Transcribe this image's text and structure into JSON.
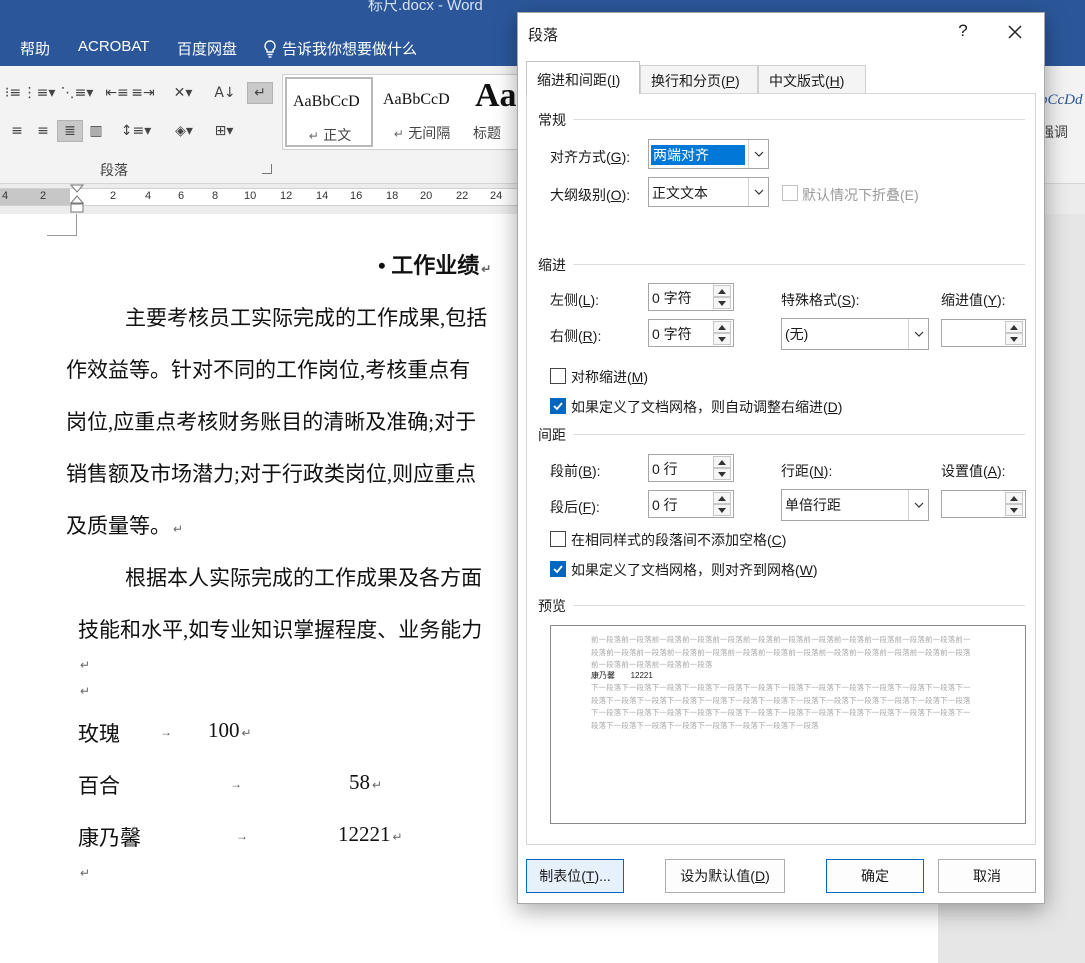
{
  "window": {
    "title": "标尺.docx - Word"
  },
  "menu": {
    "items": [
      "帮助",
      "ACROBAT",
      "百度网盘"
    ],
    "tell_me": "告诉我你想要做什么"
  },
  "ribbon": {
    "group_label": "段落",
    "styles": [
      {
        "sample": "AaBbCcD",
        "name": "正文",
        "mark": "↵"
      },
      {
        "sample": "AaBbCcD",
        "name": "无间隔",
        "mark": "↵"
      },
      {
        "sample": "Aa",
        "name": "标题"
      }
    ],
    "right_style_sample": "bCcDd",
    "right_style_name": "强调"
  },
  "ruler": {
    "labels": [
      "4",
      "2",
      "2",
      "4",
      "6",
      "8",
      "10",
      "12",
      "14",
      "16",
      "18",
      "20",
      "22",
      "24"
    ]
  },
  "document": {
    "heading": "工作业绩",
    "heading_bullet": "•",
    "lines": [
      "主要考核员工实际完成的工作成果,包括",
      "作效益等。针对不同的工作岗位,考核重点有",
      "岗位,应重点考核财务账目的清晰及准确;对于",
      "销售额及市场潜力;对于行政类岗位,则应重点",
      "及质量等。",
      "根据本人实际完成的工作成果及各方面",
      "技能和水平,如专业知识掌握程度、业务能力"
    ],
    "table_rows": [
      {
        "name": "玫瑰",
        "value": "100"
      },
      {
        "name": "百合",
        "value": "58"
      },
      {
        "name": "康乃馨",
        "value": "12221"
      }
    ],
    "para_mark": "↵",
    "tab_mark": "→"
  },
  "dialog": {
    "title": "段落",
    "help": "?",
    "tabs": [
      {
        "label": "缩进和间距(",
        "key": "I",
        "end": ")"
      },
      {
        "label": "换行和分页(",
        "key": "P",
        "end": ")"
      },
      {
        "label": "中文版式(",
        "key": "H",
        "end": ")"
      }
    ],
    "general": {
      "title": "常规",
      "alignment": {
        "label": "对齐方式(",
        "key": "G",
        "end": "):",
        "value": "两端对齐"
      },
      "outline": {
        "label": "大纲级别(",
        "key": "O",
        "end": "):",
        "value": "正文文本"
      },
      "collapse": {
        "label": "默认情况下折叠(E)"
      }
    },
    "indent": {
      "title": "缩进",
      "left": {
        "label": "左侧(",
        "key": "L",
        "end": "):",
        "value": "0 字符"
      },
      "right": {
        "label": "右侧(",
        "key": "R",
        "end": "):",
        "value": "0 字符"
      },
      "special": {
        "label": "特殊格式(",
        "key": "S",
        "end": "):",
        "value": "(无)"
      },
      "by": {
        "label": "缩进值(",
        "key": "Y",
        "end": "):",
        "value": ""
      },
      "mirror": {
        "label": "对称缩进(",
        "key": "M",
        "end": ")"
      },
      "auto_adjust": {
        "label": "如果定义了文档网格，则自动调整右缩进(",
        "key": "D",
        "end": ")"
      }
    },
    "spacing": {
      "title": "间距",
      "before": {
        "label": "段前(",
        "key": "B",
        "end": "):",
        "value": "0 行"
      },
      "after": {
        "label": "段后(",
        "key": "F",
        "end": "):",
        "value": "0 行"
      },
      "line": {
        "label": "行距(",
        "key": "N",
        "end": "):",
        "value": "单倍行距"
      },
      "at": {
        "label": "设置值(",
        "key": "A",
        "end": "):",
        "value": ""
      },
      "no_space": {
        "label": "在相同样式的段落间不添加空格(",
        "key": "C",
        "end": ")"
      },
      "snap": {
        "label": "如果定义了文档网格，则对齐到网格(",
        "key": "W",
        "end": ")"
      }
    },
    "preview": {
      "title": "预览",
      "before_text": "前一段落前一段落前一段落前一段落前一段落前一段落前一段落前一段落前一段落前一段落前一段落前一段落前一段落前一段落前一段落前一段落前一段落前一段落前一段落前一段落前一段落前一段落前一段落前一段落前一段落前一段落前一段落前一段落前一段落",
      "current_name": "康乃馨",
      "current_value": "12221",
      "after_text": "下一段落下一段落下一段落下一段落下一段落下一段落下一段落下一段落下一段落下一段落下一段落下一段落下一段落下一段落下一段落下一段落下一段落下一段落下一段落下一段落下一段落下一段落下一段落下一段落下一段落下一段落下一段落下一段落下一段落下一段落下一段落下一段落下一段落下一段落下一段落下一段落下一段落下一段落下一段落下一段落下一段落下一段落下一段落下一段落下一段落"
    },
    "buttons": {
      "tabs": {
        "label": "制表位(",
        "key": "T",
        "end": ")..."
      },
      "set_default": {
        "label": "设为默认值(",
        "key": "D",
        "end": ")"
      },
      "ok": "确定",
      "cancel": "取消"
    }
  }
}
